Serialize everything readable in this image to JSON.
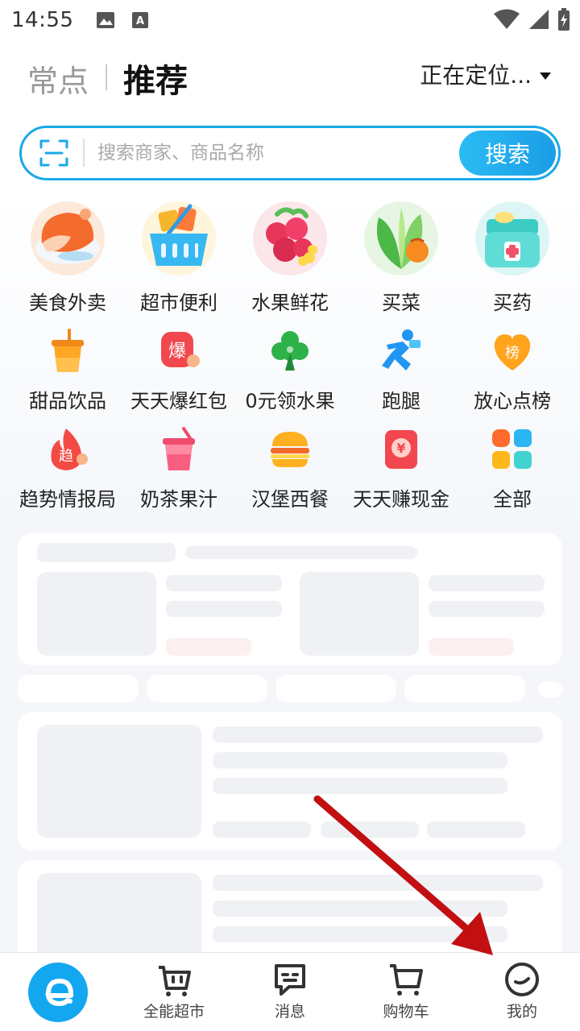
{
  "status_bar": {
    "time": "14:55",
    "icons": [
      "image-icon",
      "text-a-icon",
      "wifi-icon",
      "signal-icon",
      "battery-icon"
    ]
  },
  "header": {
    "tab_frequent": "常点",
    "tab_recommend": "推荐",
    "location": "正在定位..."
  },
  "search": {
    "placeholder": "搜索商家、商品名称",
    "button": "搜索",
    "accent": "#1aa9e8"
  },
  "categories_primary": [
    {
      "label": "美食外卖",
      "icon": "food-delivery-icon"
    },
    {
      "label": "超市便利",
      "icon": "supermarket-basket-icon"
    },
    {
      "label": "水果鲜花",
      "icon": "fruit-flower-icon"
    },
    {
      "label": "买菜",
      "icon": "vegetable-icon"
    },
    {
      "label": "买药",
      "icon": "medicine-box-icon"
    }
  ],
  "categories_secondary": [
    {
      "label": "甜品饮品",
      "icon": "drink-cup-icon"
    },
    {
      "label": "天天爆红包",
      "icon": "red-packet-icon",
      "badge": "爆"
    },
    {
      "label": "0元领水果",
      "icon": "tree-icon"
    },
    {
      "label": "跑腿",
      "icon": "runner-icon"
    },
    {
      "label": "放心点榜",
      "icon": "ranking-heart-icon",
      "badge": "榜"
    }
  ],
  "categories_tertiary": [
    {
      "label": "趋势情报局",
      "icon": "trend-flame-icon",
      "badge": "趋"
    },
    {
      "label": "奶茶果汁",
      "icon": "milk-tea-icon"
    },
    {
      "label": "汉堡西餐",
      "icon": "burger-icon"
    },
    {
      "label": "天天赚现金",
      "icon": "cash-envelope-icon",
      "badge": "¥"
    },
    {
      "label": "全部",
      "icon": "all-grid-icon"
    }
  ],
  "bottom_nav": [
    {
      "label": "",
      "icon": "eleme-home-icon"
    },
    {
      "label": "全能超市",
      "icon": "supermarket-cart-icon"
    },
    {
      "label": "消息",
      "icon": "message-icon"
    },
    {
      "label": "购物车",
      "icon": "cart-icon"
    },
    {
      "label": "我的",
      "icon": "profile-smile-icon"
    }
  ]
}
